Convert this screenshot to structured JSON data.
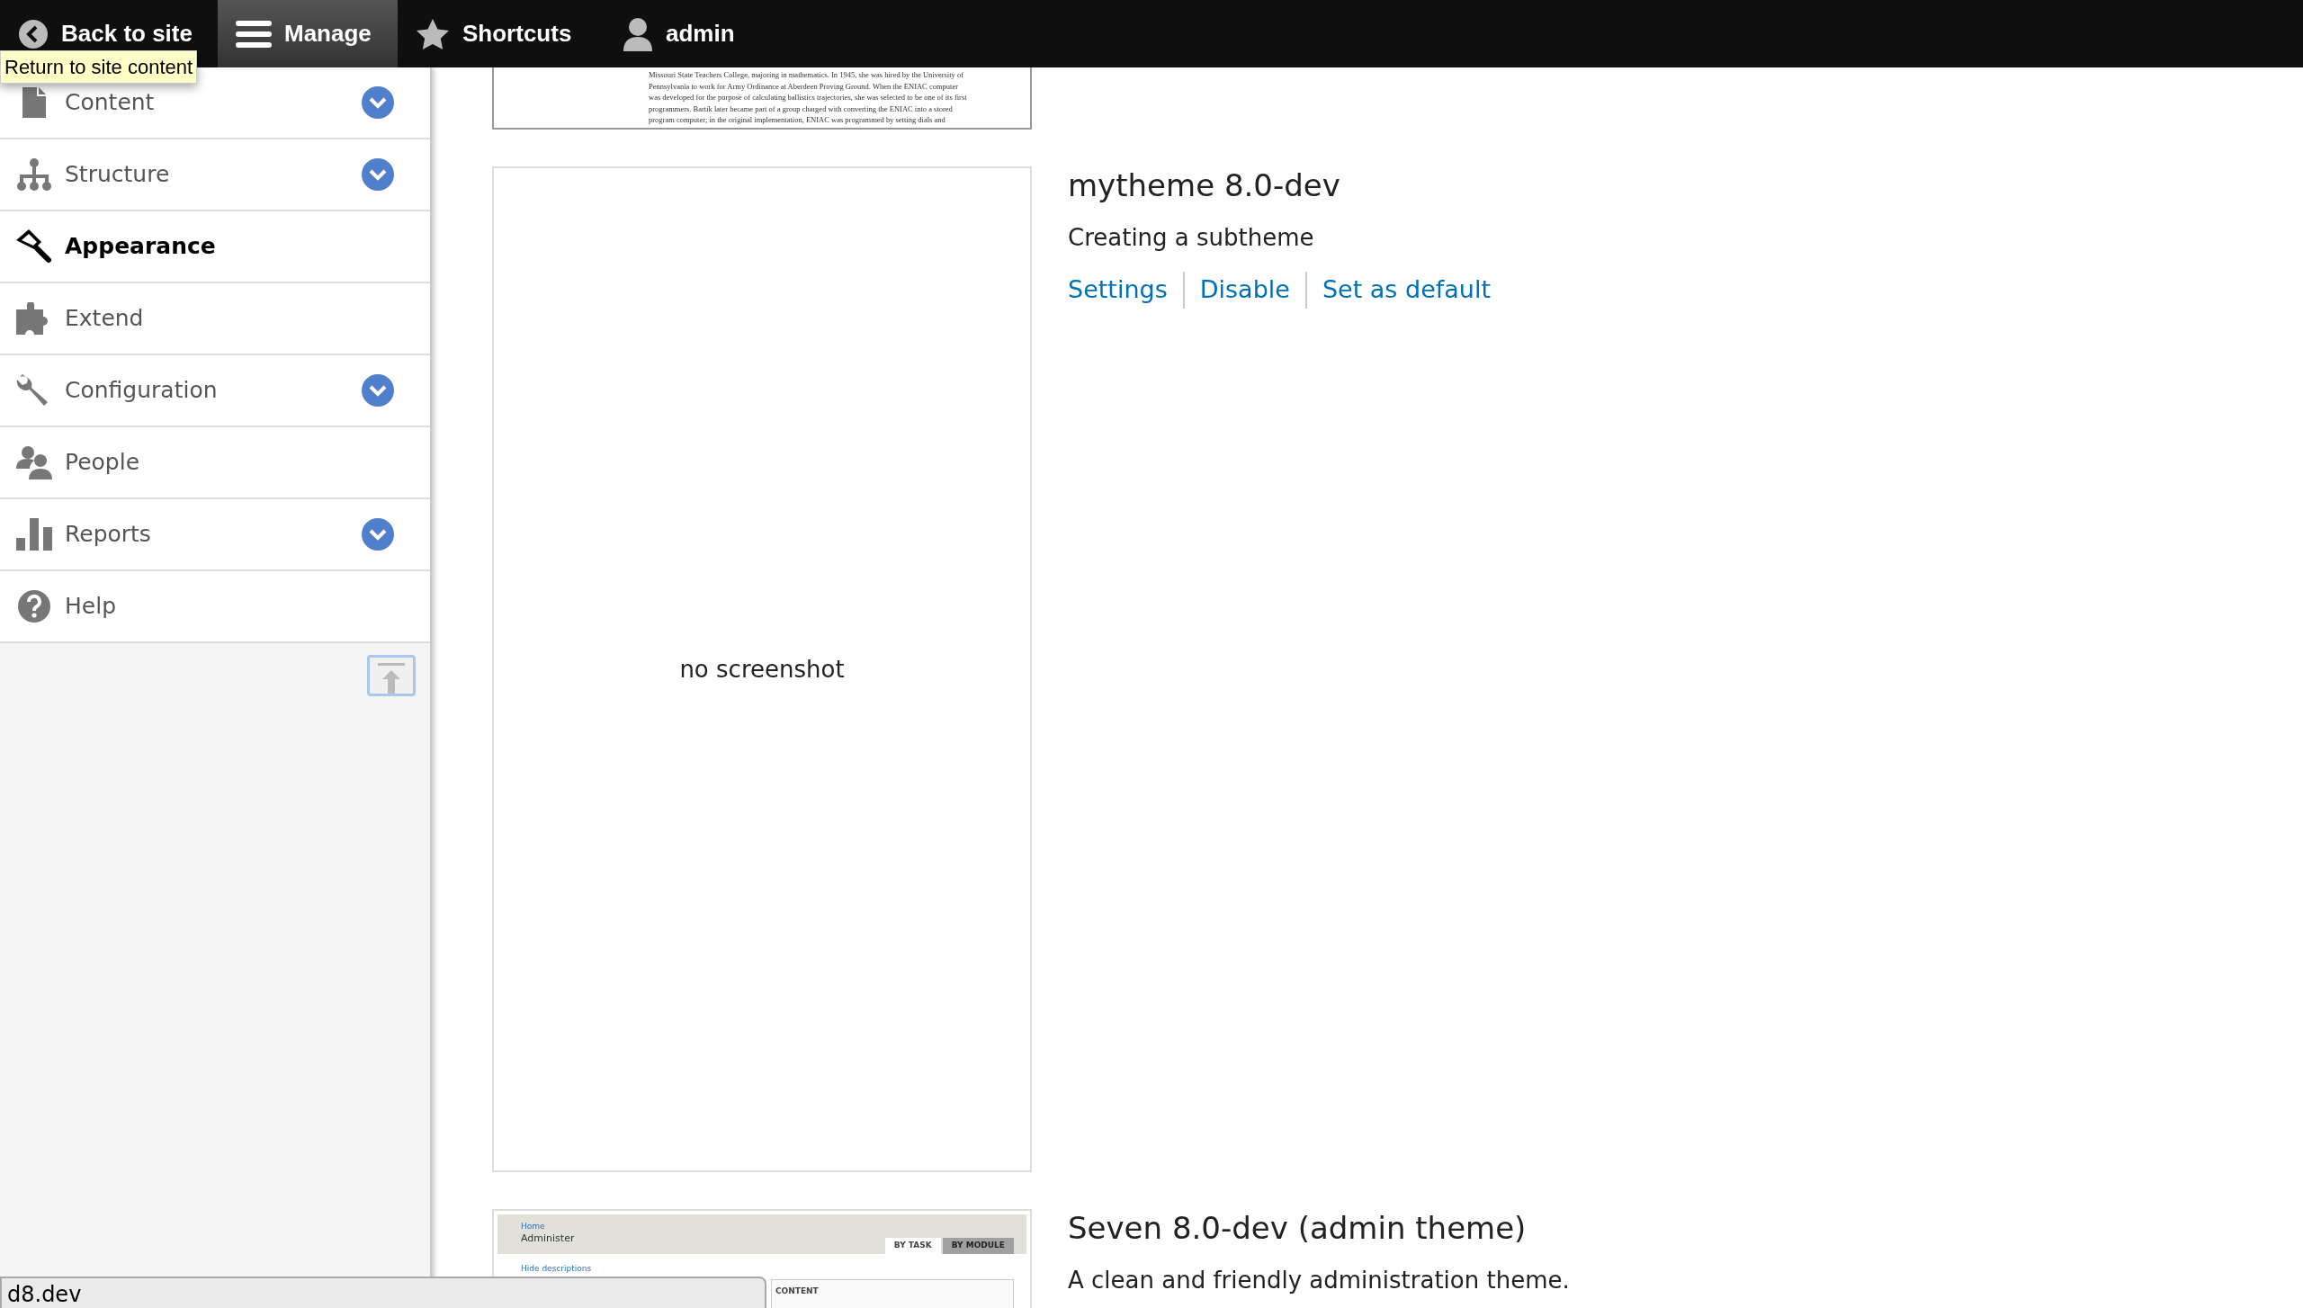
{
  "toolbar": {
    "tabs": [
      {
        "label": "Back to site",
        "selected": false
      },
      {
        "label": "Manage",
        "selected": true
      },
      {
        "label": "Shortcuts",
        "selected": false
      },
      {
        "label": "admin",
        "selected": false
      }
    ],
    "tooltip": "Return to site content"
  },
  "sidebar": {
    "items": [
      {
        "label": "Content",
        "expandable": true,
        "selected": false
      },
      {
        "label": "Structure",
        "expandable": true,
        "selected": false
      },
      {
        "label": "Appearance",
        "expandable": false,
        "selected": true
      },
      {
        "label": "Extend",
        "expandable": false,
        "selected": false
      },
      {
        "label": "Configuration",
        "expandable": true,
        "selected": false
      },
      {
        "label": "People",
        "expandable": false,
        "selected": false
      },
      {
        "label": "Reports",
        "expandable": true,
        "selected": false
      },
      {
        "label": "Help",
        "expandable": false,
        "selected": false
      }
    ]
  },
  "themes": [
    {
      "screenshot": {
        "kind": "article",
        "lines": [
          "Missouri State Teachers College, majoring in mathematics. In 1945, she was hired by the University of",
          "Pennsylvania to work for Army Ordinance at Aberdeen Proving Ground. When the ENIAC computer",
          "was developed for the purpose of calculating ballistics trajectories, she was selected to be one of its first",
          "programmers. Bartik later became part of a group charged with converting the ENIAC into a stored",
          "program computer; in the original implementation, ENIAC was programmed by setting dials and"
        ]
      }
    },
    {
      "title": "mytheme 8.0-dev",
      "description": "Creating a subtheme",
      "screenshot": {
        "kind": "none",
        "text": "no screenshot"
      },
      "links": [
        "Settings",
        "Disable",
        "Set as default"
      ]
    },
    {
      "title": "Seven 8.0-dev (admin theme)",
      "description": "A clean and friendly administration theme.",
      "screenshot": {
        "kind": "admin",
        "breadcrumb": "Home",
        "heading": "Administer",
        "tabs": [
          {
            "label": "BY TASK",
            "selected": true
          },
          {
            "label": "BY MODULE",
            "selected": false
          }
        ],
        "link": "Hide descriptions",
        "panel_title": "CONTENT"
      }
    }
  ],
  "status_bar": "d8.dev"
}
